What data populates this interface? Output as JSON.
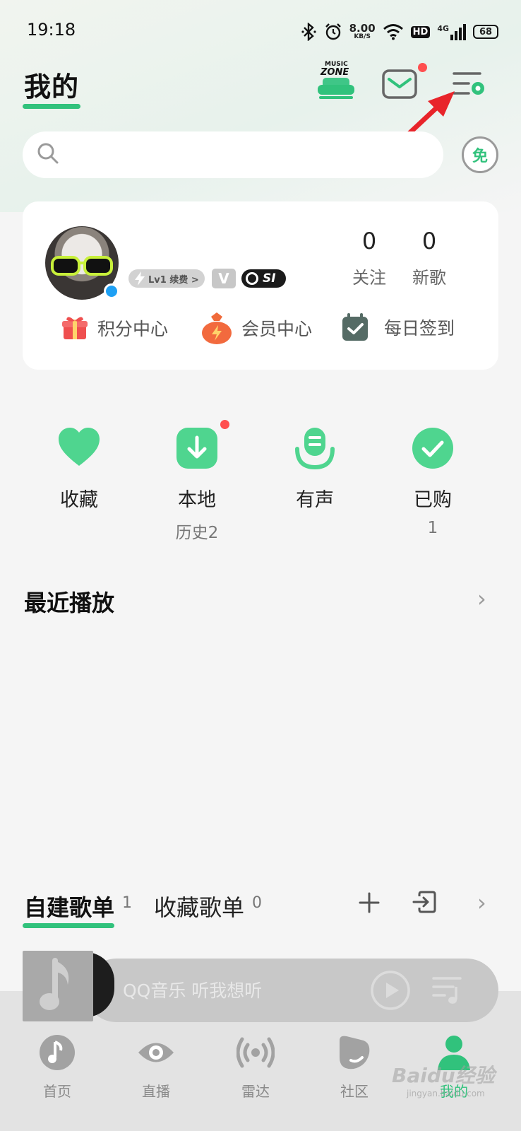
{
  "status_bar": {
    "time": "19:18",
    "speed_value": "8.00",
    "speed_unit": "KB/S",
    "hd": "HD",
    "network": "4G",
    "battery": "68"
  },
  "header": {
    "title": "我的",
    "music_zone_line1": "MUSIC",
    "music_zone_line2": "ZONE",
    "free_label": "免"
  },
  "profile": {
    "level_badge": "Lv1 续费 >",
    "vip_badge": "V",
    "sv_badge": "SI",
    "follow_count": "0",
    "follow_label": "关注",
    "new_songs_count": "0",
    "new_songs_label": "新歌",
    "links": [
      {
        "label": "积分中心",
        "icon": "gift-icon"
      },
      {
        "label": "会员中心",
        "icon": "money-bag-icon"
      },
      {
        "label": "每日签到",
        "icon": "calendar-check-icon"
      }
    ]
  },
  "quick_entries": [
    {
      "label": "收藏",
      "sub": "",
      "icon": "heart-icon"
    },
    {
      "label": "本地",
      "sub": "历史2",
      "icon": "download-icon"
    },
    {
      "label": "有声",
      "sub": "",
      "icon": "microphone-icon"
    },
    {
      "label": "已购",
      "sub": "1",
      "icon": "check-circle-icon"
    }
  ],
  "recent": {
    "title": "最近播放"
  },
  "playlists": {
    "tab_created": "自建歌单",
    "tab_created_count": "1",
    "tab_collected": "收藏歌单",
    "tab_collected_count": "0"
  },
  "mini_player": {
    "text": "QQ音乐 听我想听"
  },
  "bottom_nav": [
    {
      "label": "首页",
      "icon": "music-note-icon"
    },
    {
      "label": "直播",
      "icon": "eye-icon"
    },
    {
      "label": "雷达",
      "icon": "radar-icon"
    },
    {
      "label": "社区",
      "icon": "community-icon"
    },
    {
      "label": "我的",
      "icon": "person-icon",
      "active": true
    }
  ],
  "watermark": {
    "text": "Baidu经验",
    "sub": "jingyan.baidu.com"
  },
  "colors": {
    "accent": "#31c27c",
    "badge_red": "#ff4f4f",
    "arrow_red": "#e8242a"
  }
}
